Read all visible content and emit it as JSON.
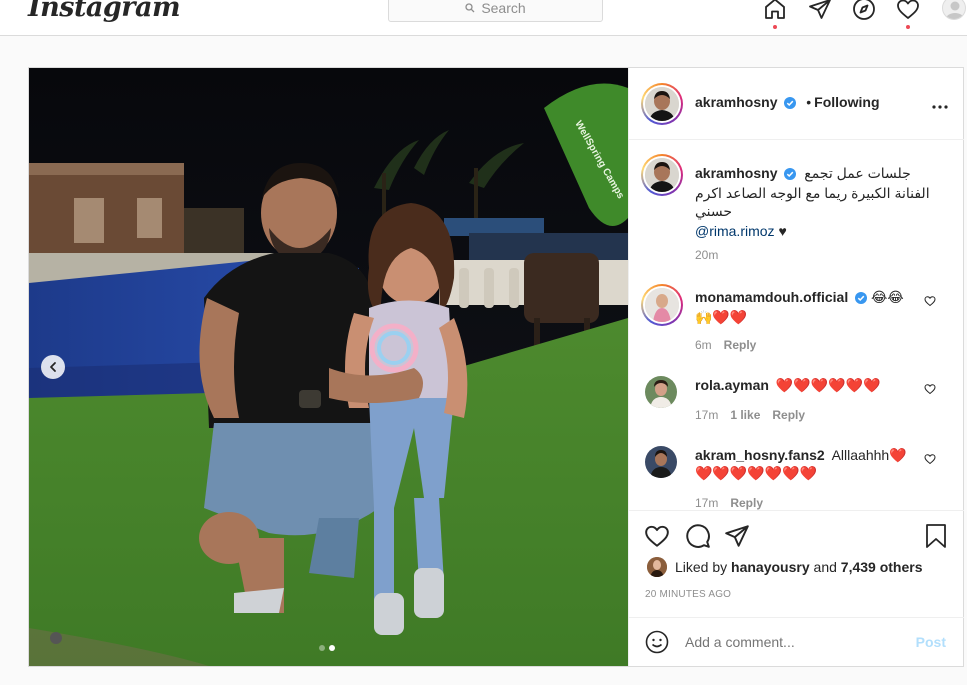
{
  "nav": {
    "logo": "Instagram",
    "search_placeholder": "Search"
  },
  "post": {
    "author": "akramhosny",
    "follow_state": "Following",
    "caption_author": "akramhosny",
    "caption_line1": "جلسات عمل تجمع",
    "caption_line2": "الفنانة الكبيرة ريما مع الوجه الصاعد اكرم",
    "caption_line3": "حسني",
    "caption_mention": "@rima.rimoz",
    "caption_suffix": "♥",
    "caption_time": "20m",
    "comments": [
      {
        "user": "monamamdouh.official",
        "verified": true,
        "text_line1": "😂😂",
        "text_line2": "🙌❤️❤️",
        "time": "6m",
        "likes": "",
        "reply": "Reply"
      },
      {
        "user": "rola.ayman",
        "verified": false,
        "text_line1": "❤️❤️❤️❤️❤️❤️",
        "text_line2": "",
        "time": "17m",
        "likes": "1 like",
        "reply": "Reply"
      },
      {
        "user": "akram_hosny.fans2",
        "verified": false,
        "text_line1": "Alllaahhh❤️",
        "text_line2": "❤️❤️❤️❤️❤️❤️❤️",
        "time": "17m",
        "likes": "",
        "reply": "Reply"
      }
    ],
    "liked_by_prefix": "Liked by",
    "liked_by_user": "hanayousry",
    "liked_by_and": "and",
    "liked_by_others": "7,439 others",
    "timestamp": "20 MINUTES AGO",
    "add_comment_placeholder": "Add a comment...",
    "post_button": "Post",
    "carousel_index": 2,
    "carousel_total": 2,
    "sign_text": "WellSpring Camps"
  },
  "colors": {
    "link": "#00376b",
    "notification_dot": "#ed4956",
    "verified_blue": "#3897f0",
    "post_disabled": "#b2dffc"
  }
}
